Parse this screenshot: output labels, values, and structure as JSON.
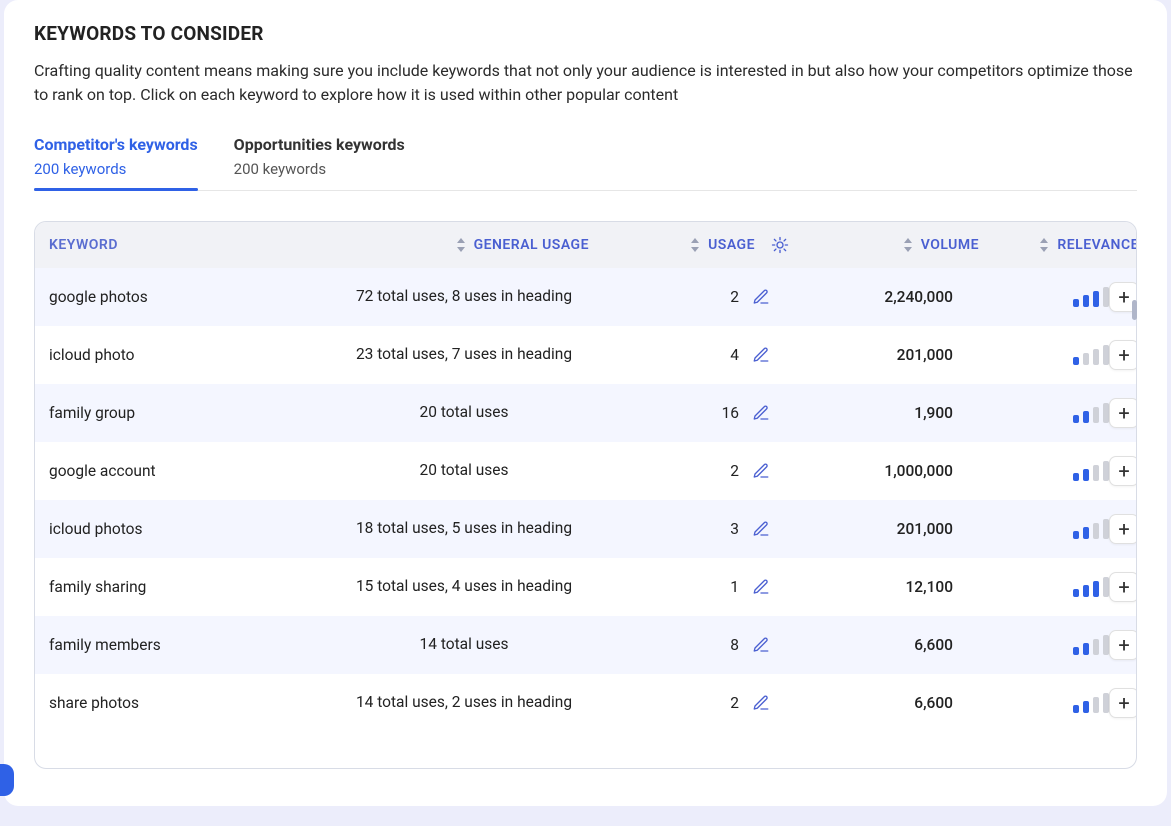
{
  "title": "KEYWORDS TO CONSIDER",
  "description": "Crafting quality content means making sure you include keywords that not only your audience is interested in but also how your competitors optimize those to rank on top. Click on each keyword to explore how it is used within other popular content",
  "tabs": [
    {
      "label": "Competitor's keywords",
      "sub": "200 keywords",
      "active": true
    },
    {
      "label": "Opportunities keywords",
      "sub": "200 keywords",
      "active": false
    }
  ],
  "columns": {
    "keyword": "KEYWORD",
    "general": "GENERAL USAGE",
    "usage": "USAGE",
    "volume": "VOLUME",
    "relevance": "RELEVANCE"
  },
  "rows": [
    {
      "keyword": "google photos",
      "general": "72 total uses, 8 uses in heading",
      "usage": "2",
      "volume": "2,240,000",
      "relevance": 3
    },
    {
      "keyword": "icloud photo",
      "general": "23 total uses, 7 uses in heading",
      "usage": "4",
      "volume": "201,000",
      "relevance": 1
    },
    {
      "keyword": "family group",
      "general": "20 total uses",
      "usage": "16",
      "volume": "1,900",
      "relevance": 2
    },
    {
      "keyword": "google account",
      "general": "20 total uses",
      "usage": "2",
      "volume": "1,000,000",
      "relevance": 2
    },
    {
      "keyword": "icloud photos",
      "general": "18 total uses, 5 uses in heading",
      "usage": "3",
      "volume": "201,000",
      "relevance": 2
    },
    {
      "keyword": "family sharing",
      "general": "15 total uses, 4 uses in heading",
      "usage": "1",
      "volume": "12,100",
      "relevance": 3
    },
    {
      "keyword": "family members",
      "general": "14 total uses",
      "usage": "8",
      "volume": "6,600",
      "relevance": 2
    },
    {
      "keyword": "share photos",
      "general": "14 total uses, 2 uses in heading",
      "usage": "2",
      "volume": "6,600",
      "relevance": 2
    }
  ]
}
